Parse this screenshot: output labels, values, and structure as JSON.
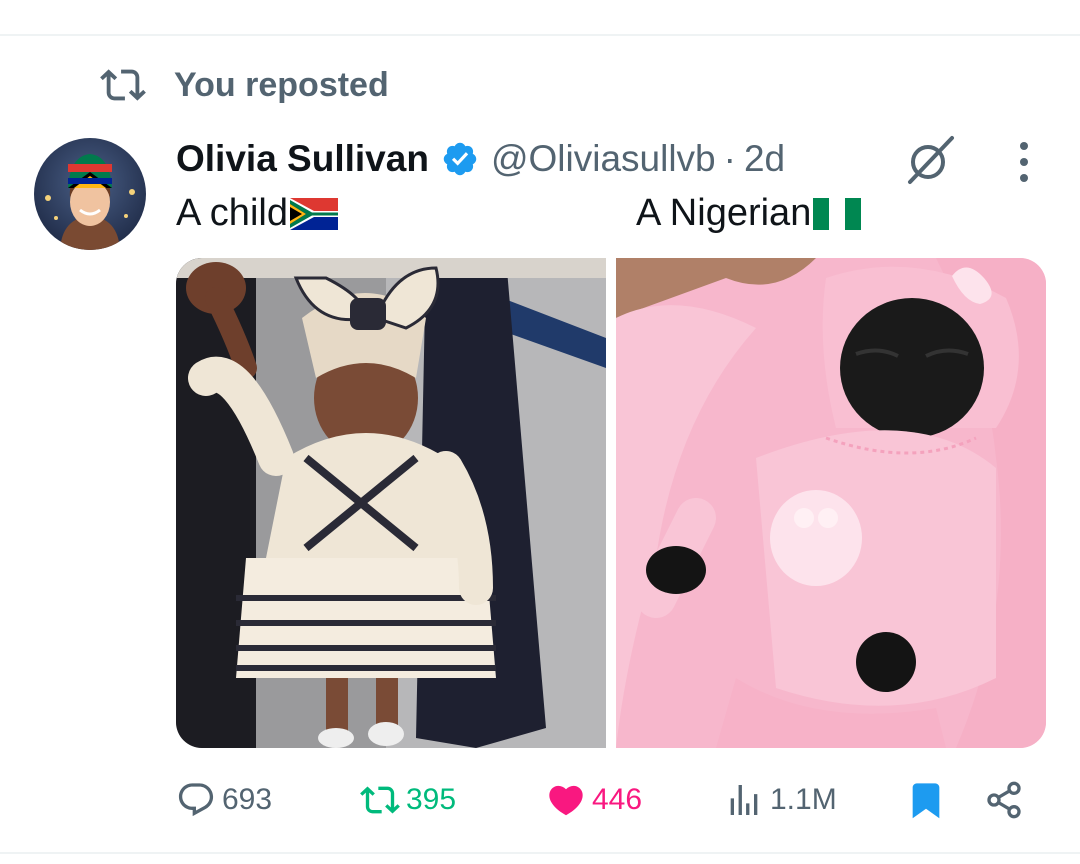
{
  "repost_banner": {
    "text": "You reposted"
  },
  "tweet": {
    "author_name": "Olivia Sullivan",
    "handle": "@Oliviasullvb",
    "separator": "·",
    "time": "2d",
    "caption_left": "A child",
    "caption_right": "A Nigerian",
    "flags": [
      "south-africa-flag-icon",
      "nigeria-flag-icon"
    ],
    "images": [
      {
        "name": "toddler-in-striped-dress-photo"
      },
      {
        "name": "doll-in-pink-blanket-photo"
      }
    ]
  },
  "actions": {
    "replies": "693",
    "reposts": "395",
    "likes": "446",
    "views": "1.1M",
    "bookmarked": true,
    "liked": true,
    "reposted": true
  },
  "colors": {
    "text_primary": "#0f1419",
    "text_secondary": "#536471",
    "verified_blue": "#1d9bf0",
    "repost_green": "#00ba7c",
    "like_pink": "#f91880",
    "bookmark_blue": "#1d9bf0",
    "divider": "#eff3f4"
  },
  "icons": {
    "repost": "repost-icon",
    "verified": "verified-badge-icon",
    "grok": "grok-icon",
    "more": "more-options-icon",
    "reply": "reply-icon",
    "like": "heart-icon",
    "views": "views-icon",
    "bookmark": "bookmark-icon",
    "share": "share-icon"
  }
}
